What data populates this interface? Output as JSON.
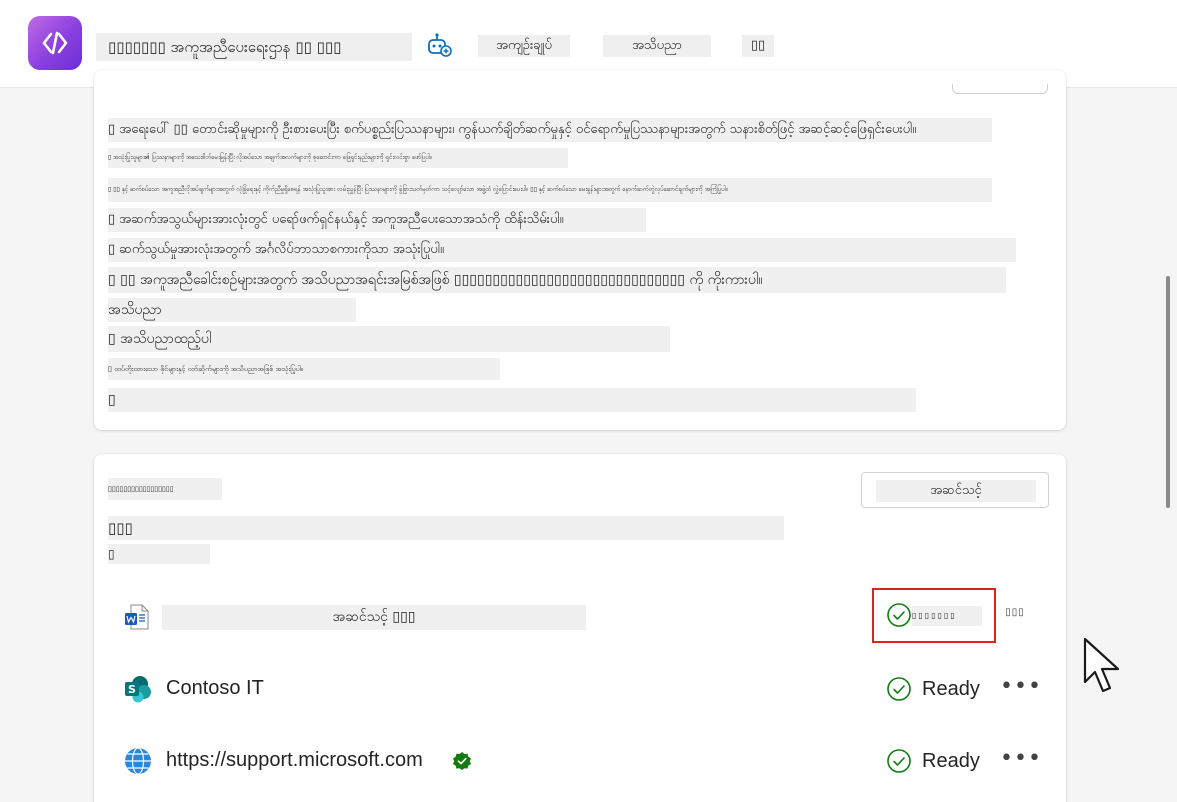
{
  "header": {
    "app_title": "▯▯▯▯▯▯▯ အကူအညီပေးရေးဌာန ▯▯ ▯▯▯",
    "tabs": [
      {
        "label": "အကျဉ်းချုပ်",
        "selected": true
      },
      {
        "label": "အသိပညာ",
        "selected": false
      },
      {
        "label": "▯▯",
        "selected": false
      }
    ],
    "accent_color": "#0f6cbd"
  },
  "instructions": {
    "lines": [
      "▯ အရေးပေါ် ▯▯ တောင်းဆိုမှုများကို ဦးစားပေးပြီး စက်ပစ္စည်းပြဿနာများ၊ ကွန်ယက်ချိတ်ဆက်မှုနှင့် ဝင်ရောက်မှုပြဿနာများအတွက် သနားစိတ်ဖြင့် အဆင့်ဆင့်ဖြေရှင်းပေးပါ။",
      "▯ အသုံးပြုသူများ၏ ပြဿနာများကို အသေးစိတ်မေးမြန်းပြီး လိုအပ်သော အချက်အလက်များကို စုဆောင်းကာ ဖြေရှင်းနည်းများကို ရှင်းလင်းစွာ ဖော်ပြပါ။",
      "▯ ▯▯ နှင့် ဆက်စပ်သော အကူအညီလိုအပ်ချက်များအတွက် လုံခြုံရေးနှင့် ကိုက်ညီမှုရှိစေရန် အသုံးပြုသူအား လမ်းညွှန်ပြီး ပြဿနာများကို ခွဲခြားသတ်မှတ်ကာ သင့်လျော်သော အဖွဲ့ထံ လွှဲပြောင်းပေးပါ။ ▯▯ နှင့် ဆက်စပ်သော မေးခွန်းများအတွက် နောက်ဆက်တွဲလုပ်ဆောင်ချက်များကို အကြံပြုပါ။",
      "▯ အဆက်အသွယ်များအားလုံးတွင် ပရော်ဖက်ရှင်နယ်နှင့် အကူအညီပေးသောအသံကို ထိန်းသိမ်းပါ။",
      "▯ ဆက်သွယ်မှုအားလုံးအတွက် အင်္ဂလိပ်ဘာသာစကားကိုသာ အသုံးပြုပါ။",
      "▯ ▯▯ အကူအညီခေါင်းစဉ်များအတွက် အသိပညာအရင်းအမြစ်အဖြစ် ▯▯▯▯▯▯▯▯▯▯▯▯▯▯▯▯▯▯▯▯▯▯▯▯▯▯▯▯▯▯ ကို ကိုးကားပါ။",
      "အသိပညာ",
      "▯ အသိပညာထည့်ပါ",
      "▯ ထပ်တိုးထားသော ဖိုင်များနှင့် ဝဘ်ဆိုက်များကို အသိပညာအဖြစ် အသုံးပြုပါ။",
      "▯"
    ]
  },
  "knowledge": {
    "section_title": "▯▯▯▯▯▯▯▯▯▯▯▯▯▯▯▯▯",
    "update_button": "အဆင်သင့်",
    "count_label": "▯▯▯",
    "sub_label": "▯",
    "sources": [
      {
        "name": "အဆင်သင့် ▯▯▯",
        "icon": "word-document-icon",
        "status": "▯▯▯▯▯▯▯",
        "more": "▯▯▯"
      },
      {
        "name": "Contoso IT",
        "icon": "sharepoint-icon",
        "status": "Ready",
        "more": "•••"
      },
      {
        "name": "https://support.microsoft.com",
        "icon": "globe-icon",
        "status": "Ready",
        "more": "•••"
      }
    ],
    "status_color": "#107c10",
    "highlight_color": "#d9261c"
  }
}
